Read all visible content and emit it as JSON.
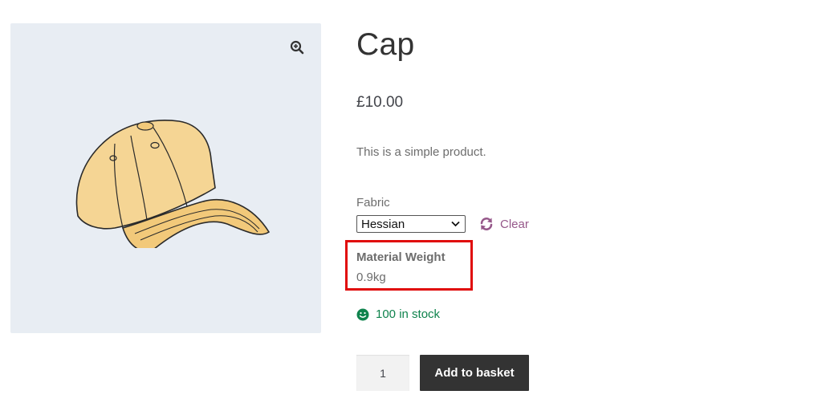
{
  "product": {
    "title": "Cap",
    "price": "£10.00",
    "description": "This is a simple product."
  },
  "variation": {
    "label": "Fabric",
    "selected": "Hessian",
    "clear_label": "Clear"
  },
  "attribute": {
    "label": "Material Weight",
    "value": "0.9kg"
  },
  "stock": {
    "text": "100 in stock"
  },
  "cart": {
    "quantity": "1",
    "add_label": "Add to basket"
  },
  "icons": {
    "zoom": "zoom-in-icon",
    "clear": "refresh-icon",
    "stock": "smiley-icon",
    "select": "chevron-down-icon"
  },
  "colors": {
    "accent": "#96588a",
    "stock": "#0f834d",
    "highlight": "#e00b0b",
    "button": "#333333",
    "gallery_bg": "#e8edf3"
  }
}
